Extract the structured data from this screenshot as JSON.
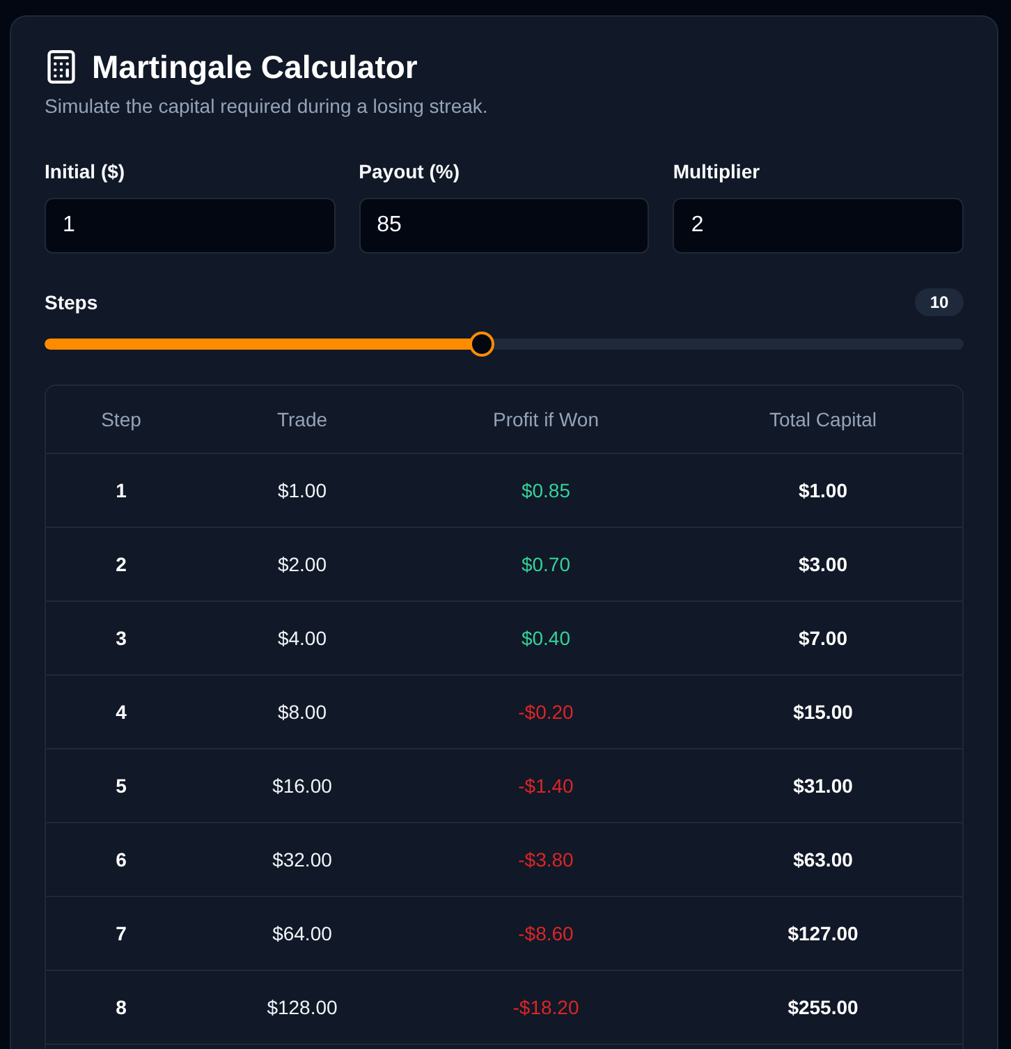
{
  "header": {
    "title": "Martingale Calculator",
    "subtitle": "Simulate the capital required during a losing streak."
  },
  "fields": [
    {
      "label": "Initial ($)",
      "value": "1"
    },
    {
      "label": "Payout (%)",
      "value": "85"
    },
    {
      "label": "Multiplier",
      "value": "2"
    }
  ],
  "steps": {
    "label": "Steps",
    "value": "10",
    "level": 0.475
  },
  "table": {
    "columns": [
      "Step",
      "Trade",
      "Profit if Won",
      "Total Capital"
    ],
    "rows": [
      {
        "step": "1",
        "trade": "$1.00",
        "profit": {
          "text": "$0.85",
          "kind": "gain"
        },
        "total": "$1.00"
      },
      {
        "step": "2",
        "trade": "$2.00",
        "profit": {
          "text": "$0.70",
          "kind": "gain"
        },
        "total": "$3.00"
      },
      {
        "step": "3",
        "trade": "$4.00",
        "profit": {
          "text": "$0.40",
          "kind": "gain"
        },
        "total": "$7.00"
      },
      {
        "step": "4",
        "trade": "$8.00",
        "profit": {
          "text": "-$0.20",
          "kind": "loss"
        },
        "total": "$15.00"
      },
      {
        "step": "5",
        "trade": "$16.00",
        "profit": {
          "text": "-$1.40",
          "kind": "loss"
        },
        "total": "$31.00"
      },
      {
        "step": "6",
        "trade": "$32.00",
        "profit": {
          "text": "-$3.80",
          "kind": "loss"
        },
        "total": "$63.00"
      },
      {
        "step": "7",
        "trade": "$64.00",
        "profit": {
          "text": "-$8.60",
          "kind": "loss"
        },
        "total": "$127.00"
      },
      {
        "step": "8",
        "trade": "$128.00",
        "profit": {
          "text": "-$18.20",
          "kind": "loss"
        },
        "total": "$255.00"
      }
    ]
  }
}
